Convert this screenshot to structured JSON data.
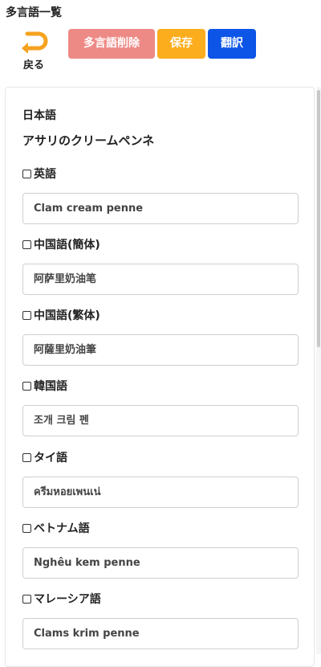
{
  "page_title": "多言語一覧",
  "toolbar": {
    "back_label": "戻る",
    "delete_label": "多言語削除",
    "save_label": "保存",
    "translate_label": "翻訳",
    "colors": {
      "delete": "#ee8a86",
      "save": "#fcad1d",
      "translate": "#0d55e6",
      "back_icon": "#f6a21e"
    }
  },
  "source": {
    "label": "日本語",
    "value": "アサリのクリームペンネ"
  },
  "languages": [
    {
      "label": "英語",
      "value": "Clam cream penne",
      "checked": false
    },
    {
      "label": "中国語(簡体)",
      "value": "阿萨里奶油笔",
      "checked": false
    },
    {
      "label": "中国語(繁体)",
      "value": "阿薩里奶油筆",
      "checked": false
    },
    {
      "label": "韓国語",
      "value": "조개 크림 펜",
      "checked": false
    },
    {
      "label": "タイ語",
      "value": "ครีมหอยเพนเน่",
      "checked": false
    },
    {
      "label": "ベトナム語",
      "value": "Nghêu kem penne",
      "checked": false
    },
    {
      "label": "マレーシア語",
      "value": "Clams krim penne",
      "checked": false
    }
  ]
}
